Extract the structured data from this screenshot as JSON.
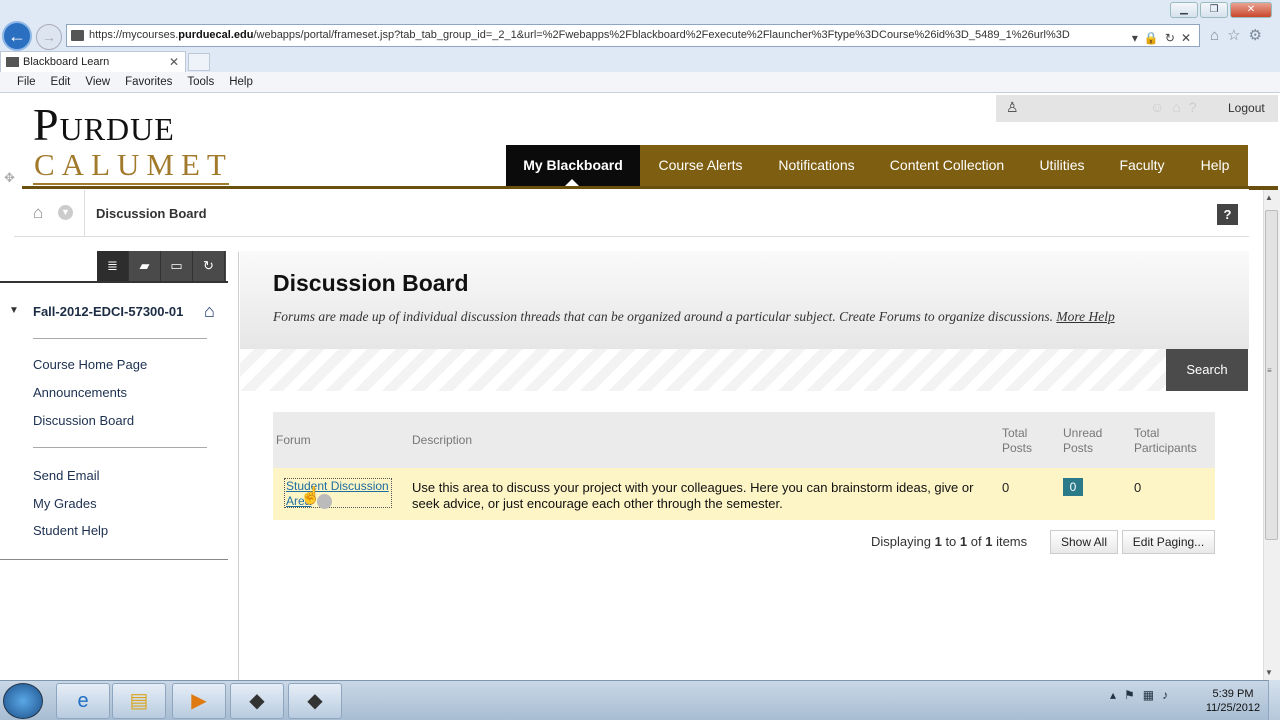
{
  "browser": {
    "url_prefix": "https://mycourses.",
    "url_domain": "purduecal.edu",
    "url_rest": "/webapps/portal/frameset.jsp?tab_tab_group_id=_2_1&url=%2Fwebapps%2Fblackboard%2Fexecute%2Flauncher%3Ftype%3DCourse%26id%3D_5489_1%26url%3D",
    "tab_title": "Blackboard Learn",
    "menu": [
      "File",
      "Edit",
      "View",
      "Favorites",
      "Tools",
      "Help"
    ]
  },
  "logo": {
    "line1": "Purdue",
    "line2": "CALUMET"
  },
  "util": {
    "logout": "Logout"
  },
  "nav": [
    "My Blackboard",
    "Course Alerts",
    "Notifications",
    "Content Collection",
    "Utilities",
    "Faculty",
    "Help"
  ],
  "breadcrumb": {
    "current": "Discussion Board",
    "help": "?"
  },
  "sidebar": {
    "course": "Fall-2012-EDCI-57300-01",
    "group1": [
      "Course Home Page",
      "Announcements",
      "Discussion Board"
    ],
    "group2": [
      "Send Email",
      "My Grades",
      "Student Help"
    ]
  },
  "main": {
    "title": "Discussion Board",
    "desc": "Forums are made up of individual discussion threads that can be organized around a particular subject. Create Forums to organize discussions.",
    "more_help": "More Help",
    "search": "Search"
  },
  "table": {
    "headers": {
      "forum": "Forum",
      "description": "Description",
      "total_posts_1": "Total",
      "total_posts_2": "Posts",
      "unread_1": "Unread",
      "unread_2": "Posts",
      "participants_1": "Total",
      "participants_2": "Participants"
    },
    "row": {
      "forum": "Student Discussion Area",
      "description": "Use this area to discuss your project with your colleagues. Here you can brainstorm ideas, give or seek advice, or just encourage each other through the semester.",
      "total_posts": "0",
      "unread": "0",
      "participants": "0"
    }
  },
  "paging": {
    "pre": "Displaying ",
    "from": "1",
    "to_label": " to ",
    "to": "1",
    "of_label": " of ",
    "total": "1",
    "post": " items",
    "show_all": "Show All",
    "edit_paging": "Edit Paging..."
  },
  "taskbar": {
    "time": "5:39 PM",
    "date": "11/25/2012"
  }
}
